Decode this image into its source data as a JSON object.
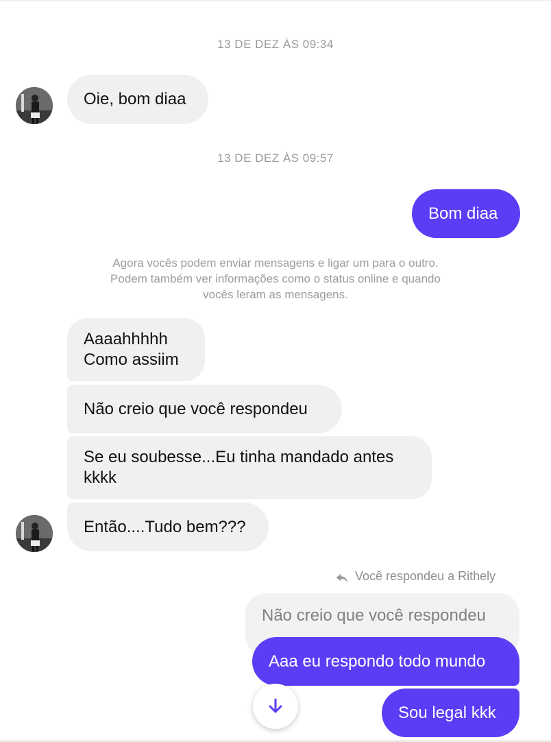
{
  "timestamps": [
    "13 DE DEZ ÀS 09:34",
    "13 DE DEZ ÀS 09:57"
  ],
  "messages": {
    "m1": "Oie, bom diaa",
    "m2": "Bom diaa",
    "m3_line1": "Aaaahhhhh",
    "m3_line2": "Como assiim",
    "m4": "Não creio que você respondeu",
    "m5_line1": "Se eu soubesse...Eu tinha mandado antes",
    "m5_line2": "kkkk",
    "m6": "Então....Tudo bem???",
    "m7": "Aaa eu respondo todo mundo",
    "m8": "Sou legal kkk"
  },
  "system_note": {
    "line1": "Agora vocês podem enviar mensagens e ligar um para o outro.",
    "line2": "Podem também ver informações como o status online e quando",
    "line3": "vocês leram as mensagens."
  },
  "reply": {
    "label": "Você respondeu a Rithely",
    "quoted_text": "Não creio que você respondeu"
  },
  "colors": {
    "outgoing_bubble": "#5b3df5",
    "incoming_bubble": "#f0f0f0"
  },
  "icons": {
    "reply": "reply-arrow-icon",
    "scroll_down": "arrow-down-icon"
  }
}
